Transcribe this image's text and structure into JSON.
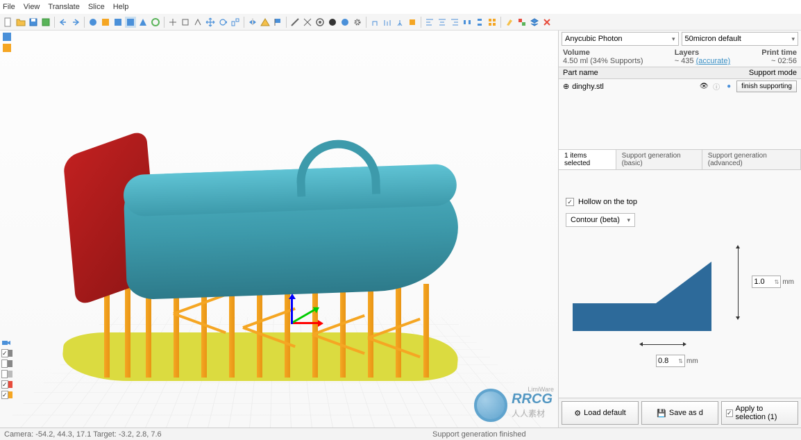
{
  "menubar": {
    "file": "File",
    "view": "View",
    "translate": "Translate",
    "slice": "Slice",
    "help": "Help"
  },
  "printer_select": "Anycubic Photon",
  "profile_select": "50micron default",
  "volume": {
    "label": "Volume",
    "value": "4.50 ml (34% Supports)"
  },
  "layers": {
    "label": "Layers",
    "value": "~ 435",
    "accurate": "(accurate)"
  },
  "print_time": {
    "label": "Print time",
    "value": "~ 02:56"
  },
  "parts_header": {
    "name": "Part name",
    "mode": "Support mode"
  },
  "part": {
    "name": "dinghy.stl",
    "prefix": "⊕",
    "finish": "finish supporting"
  },
  "tabs": {
    "selected": "1 items selected",
    "basic": "Support generation (basic)",
    "advanced": "Support generation (advanced)"
  },
  "options": {
    "hollow_label": "Hollow on the top",
    "contour_select": "Contour (beta)",
    "dim_v": "1.0",
    "dim_h": "0.8",
    "unit": "mm",
    "spin": "⇅"
  },
  "buttons": {
    "load_icon": "⚙",
    "load": "Load default",
    "save_icon": "💾",
    "save": "Save as d",
    "apply": "Apply to selection (1)"
  },
  "statusbar": {
    "camera": "Camera:  -54.2, 44.3, 17.1    Target:  -3.2, 2.8, 7.6",
    "center": "Support generation finished"
  },
  "watermark": "LimiWare",
  "brand": {
    "name": "RRCG",
    "sub": "人人素材"
  },
  "icons": {
    "eye": "👁",
    "blue_dot": "●",
    "check": "✓"
  }
}
